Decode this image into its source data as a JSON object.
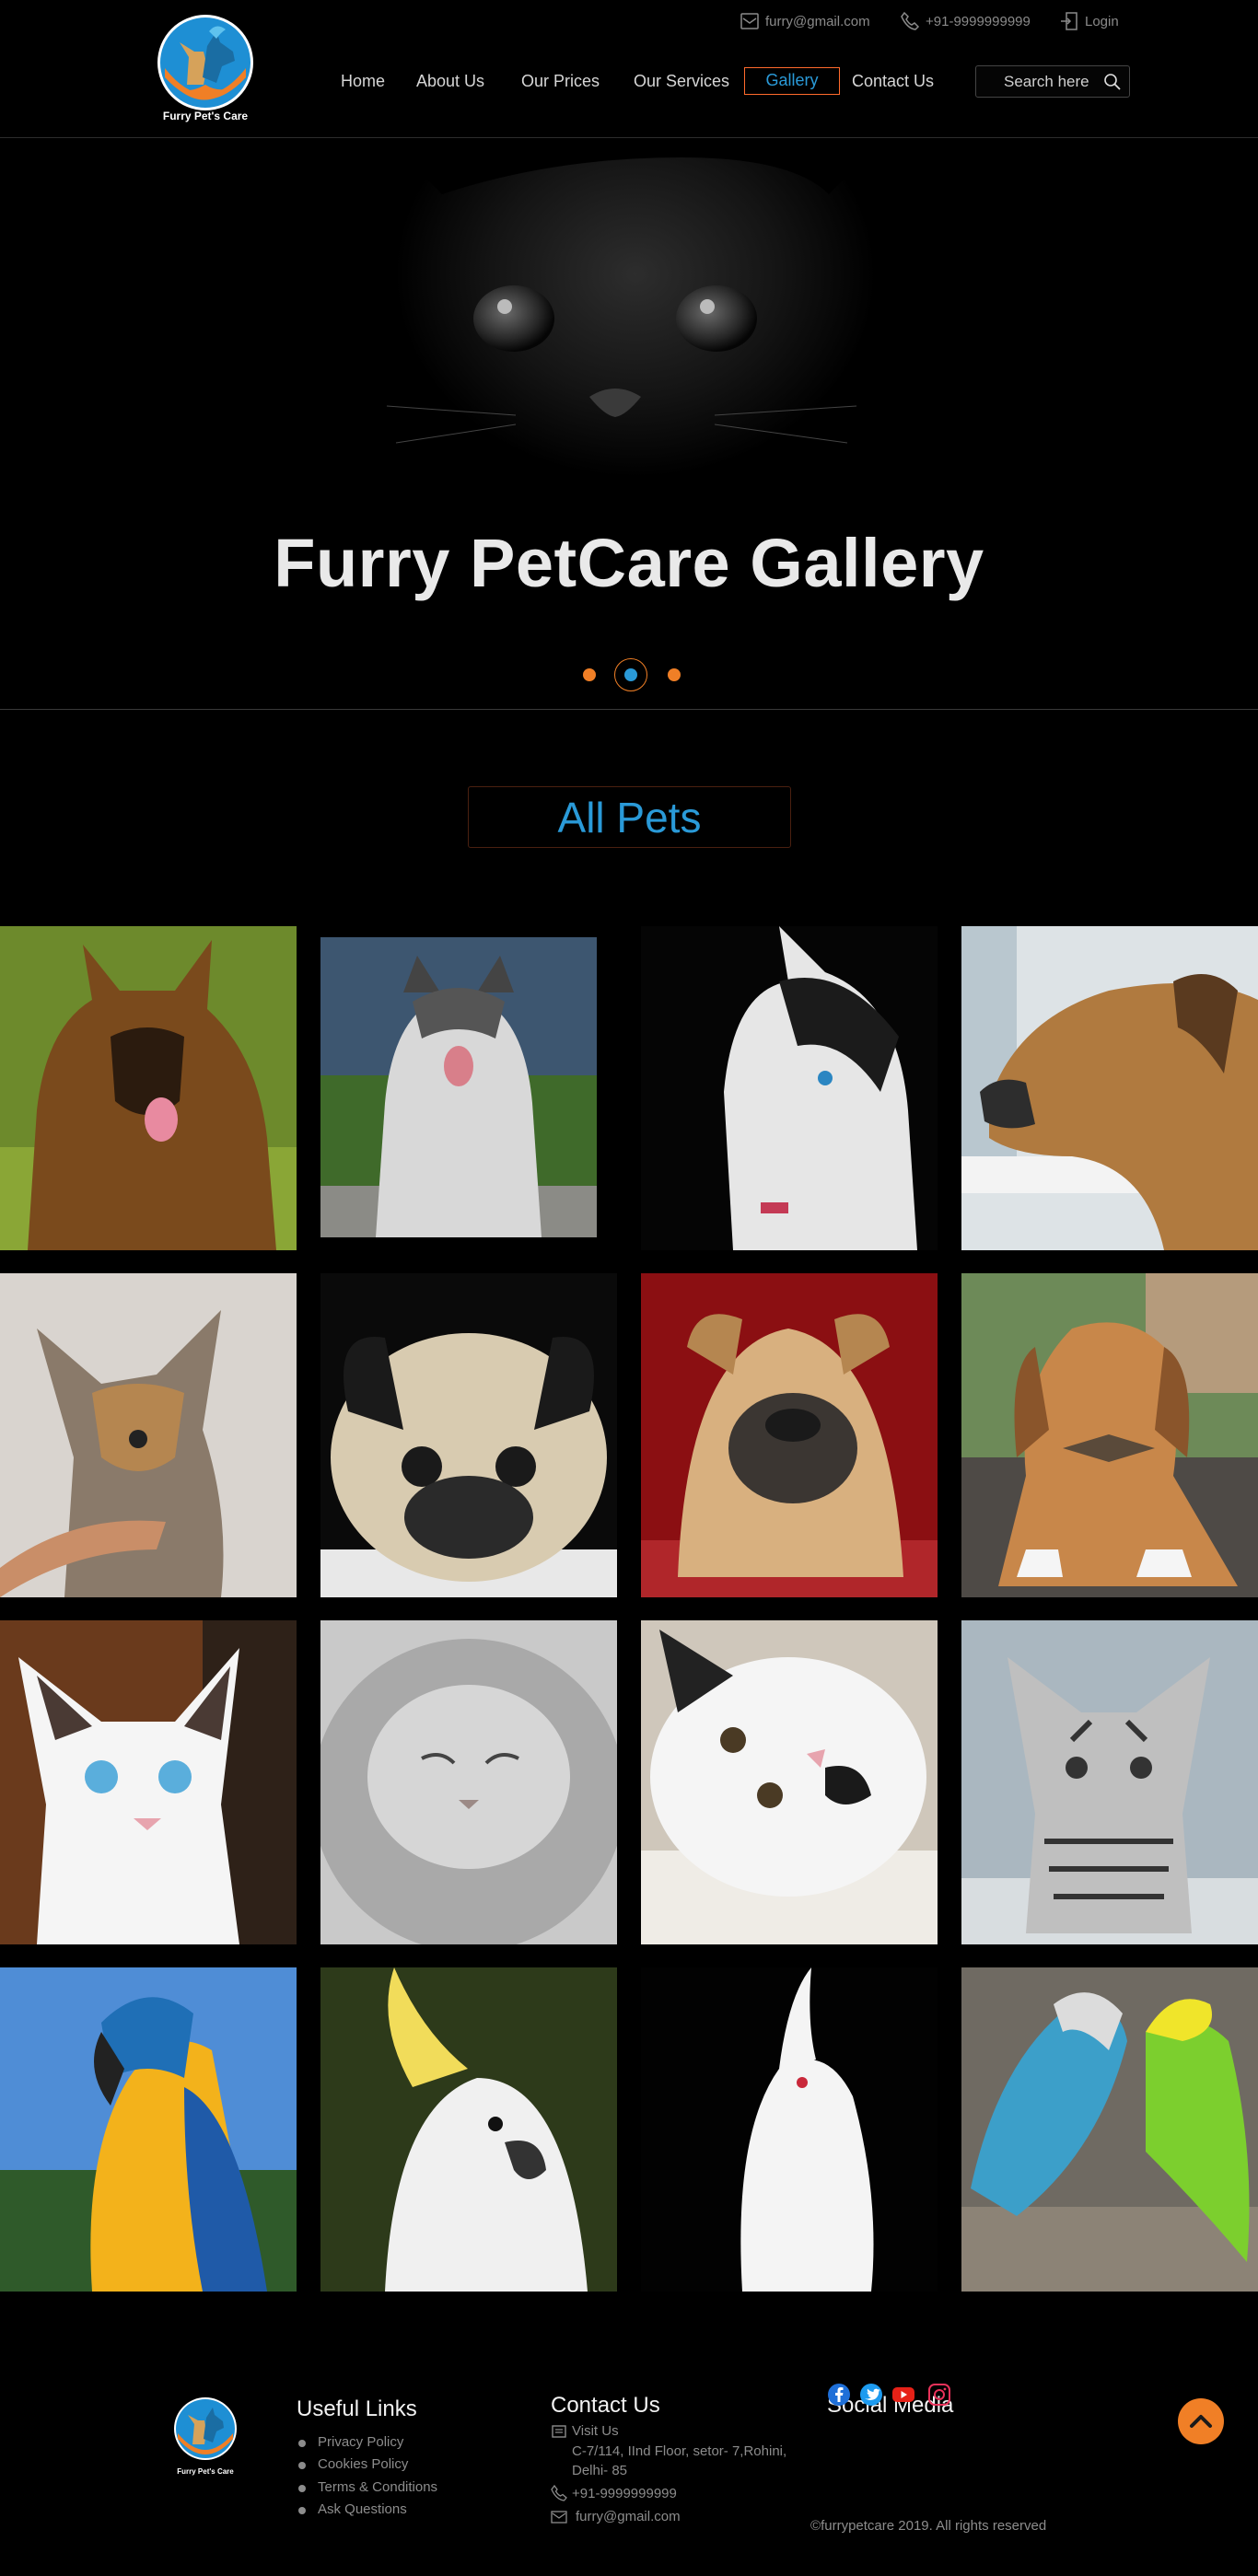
{
  "brand": {
    "name": "Furry Pet's Care",
    "colors": {
      "accent_orange": "#f07f26",
      "accent_blue": "#2a9ad8",
      "background": "#000000",
      "active_border": "#ff6a2c"
    }
  },
  "topbar": {
    "email": "furry@gmail.com",
    "phone": "+91-9999999999",
    "login": "Login"
  },
  "nav": {
    "items": [
      {
        "label": "Home"
      },
      {
        "label": "About Us"
      },
      {
        "label": "Our Prices"
      },
      {
        "label": "Our Services"
      },
      {
        "label": "Gallery",
        "active": true
      },
      {
        "label": "Contact Us"
      }
    ],
    "search_placeholder": "Search here"
  },
  "hero": {
    "title": "Furry PetCare Gallery",
    "slides_total": 3,
    "active_slide": 2
  },
  "gallery": {
    "heading": "All Pets",
    "images": [
      {
        "icon": "german-shepherd-photo"
      },
      {
        "icon": "husky-on-grass-photo"
      },
      {
        "icon": "husky-dark-photo"
      },
      {
        "icon": "great-dane-window-photo"
      },
      {
        "icon": "yorkshire-terrier-photo"
      },
      {
        "icon": "pug-photo"
      },
      {
        "icon": "shar-pei-photo"
      },
      {
        "icon": "beagle-bowtie-photo"
      },
      {
        "icon": "siamese-kitten-photo"
      },
      {
        "icon": "persian-cat-photo"
      },
      {
        "icon": "white-cat-lying-photo"
      },
      {
        "icon": "tabby-kitten-photo"
      },
      {
        "icon": "macaw-photo"
      },
      {
        "icon": "cockatoo-photo"
      },
      {
        "icon": "cockatiel-photo"
      },
      {
        "icon": "budgies-photo"
      }
    ]
  },
  "footer": {
    "useful_links": {
      "heading": "Useful Links",
      "items": [
        "Privacy Policy",
        "Cookies Policy",
        "Terms & Conditions",
        "Ask Questions"
      ]
    },
    "contact": {
      "heading": "Contact Us",
      "visit_label": "Visit Us",
      "address_line1": "C-7/114, IInd Floor, setor- 7,Rohini,",
      "address_line2": "Delhi- 85",
      "phone": "+91-9999999999",
      "email": "furry@gmail.com"
    },
    "social": {
      "heading": "Social Media",
      "icons": [
        "facebook-icon",
        "twitter-icon",
        "youtube-icon",
        "instagram-icon"
      ]
    },
    "copyright": "furrypetcare 2019. All rights reserved"
  }
}
